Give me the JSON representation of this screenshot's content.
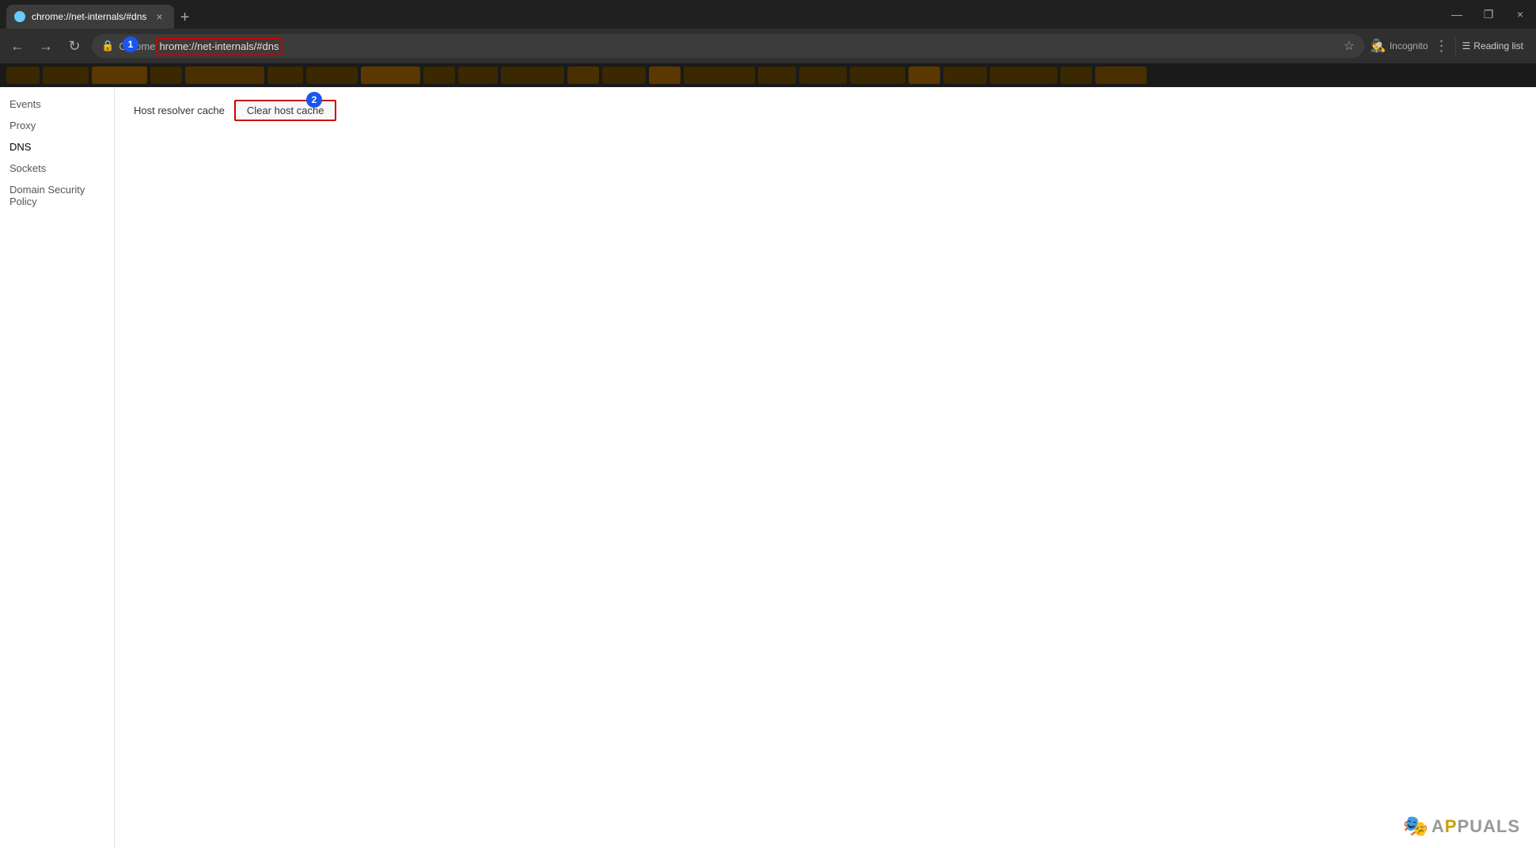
{
  "titlebar": {
    "tab_title": "chrome://net-internals/#dns",
    "tab_close_label": "×",
    "tab_new_label": "+",
    "btn_minimize": "—",
    "btn_restore": "❐",
    "btn_close": "×"
  },
  "addressbar": {
    "back_btn": "←",
    "forward_btn": "→",
    "reload_btn": "↻",
    "url_prefix": "Chrome",
    "url_highlighted": "hrome://net-internals/#dns",
    "full_url": "chrome://net-internals/#dns",
    "star_icon": "☆",
    "incognito_label": "Incognito",
    "more_icon": "⋮",
    "reading_list_icon": "☰",
    "reading_list_label": "Reading list"
  },
  "sidebar": {
    "items": [
      {
        "label": "Events",
        "active": false
      },
      {
        "label": "Proxy",
        "active": false
      },
      {
        "label": "DNS",
        "active": true
      },
      {
        "label": "Sockets",
        "active": false
      },
      {
        "label": "Domain Security Policy",
        "active": false
      }
    ]
  },
  "main": {
    "host_resolver_label": "Host resolver cache",
    "clear_btn_label": "Clear host cache"
  },
  "annotations": {
    "circle_1": "1",
    "circle_2": "2"
  },
  "watermark": {
    "text": "APPUALS"
  }
}
